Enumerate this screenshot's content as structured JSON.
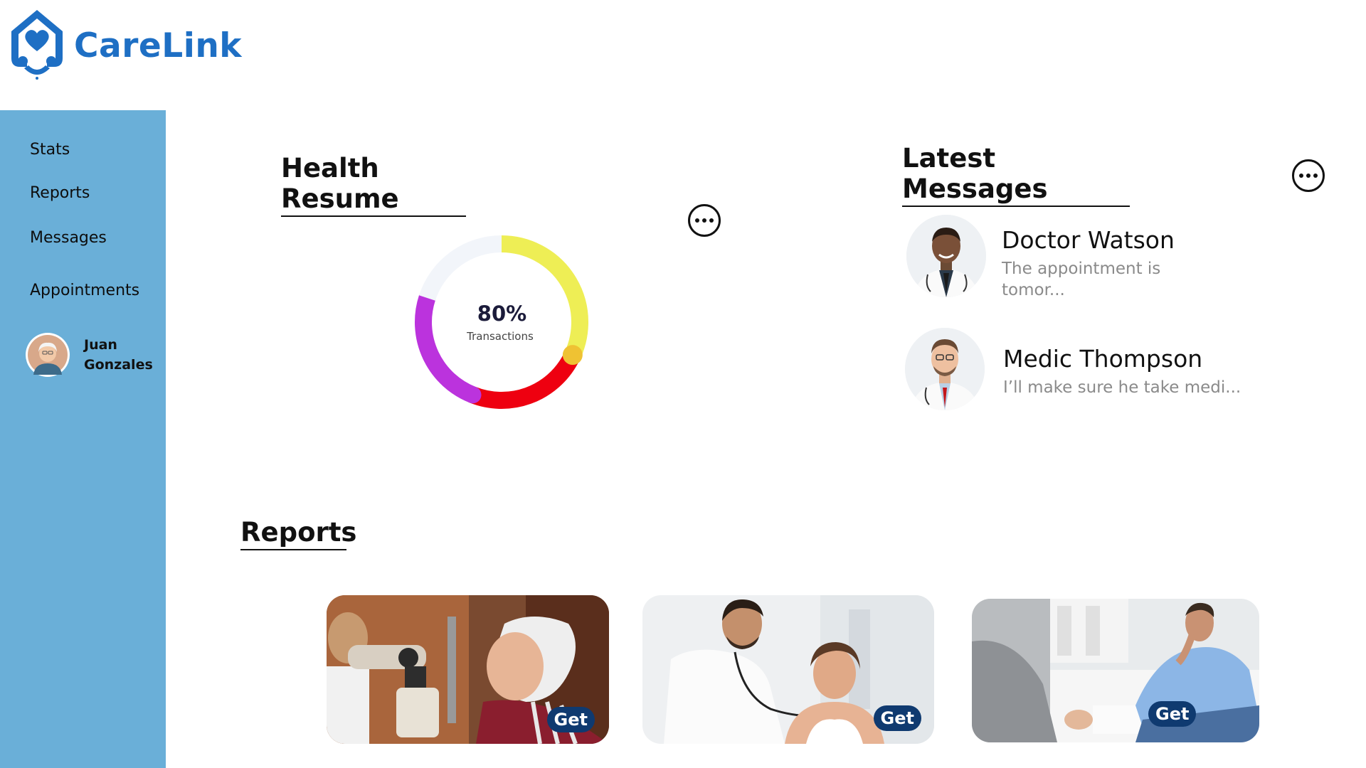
{
  "app": {
    "name": "CareLink",
    "brand_color": "#1e6fc4",
    "sidebar_color": "#6aafd8"
  },
  "sidebar": {
    "items": [
      {
        "label": "Stats"
      },
      {
        "label": "Reports"
      },
      {
        "label": "Messages"
      },
      {
        "label": "Appointments"
      }
    ],
    "user": {
      "first_name": "Juan",
      "last_name": "Gonzales"
    }
  },
  "health_resume": {
    "title": "Health Resume",
    "value": "80%",
    "label": "Transactions",
    "segments": [
      {
        "color": "#eeee55",
        "fraction": 0.33
      },
      {
        "color": "#ee0010",
        "fraction": 0.23
      },
      {
        "color": "#bb33dd",
        "fraction": 0.24
      },
      {
        "color": "#f2f5fa",
        "fraction": 0.2
      }
    ]
  },
  "messages": {
    "title": "Latest Messages",
    "items": [
      {
        "sender": "Doctor Watson",
        "preview": "The appointment is tomor..."
      },
      {
        "sender": "Medic Thompson",
        "preview": "I’ll make sure he take medi..."
      }
    ]
  },
  "reports": {
    "title": "Reports",
    "cards": [
      {
        "button": "Get"
      },
      {
        "button": "Get"
      },
      {
        "button": "Get"
      }
    ]
  }
}
